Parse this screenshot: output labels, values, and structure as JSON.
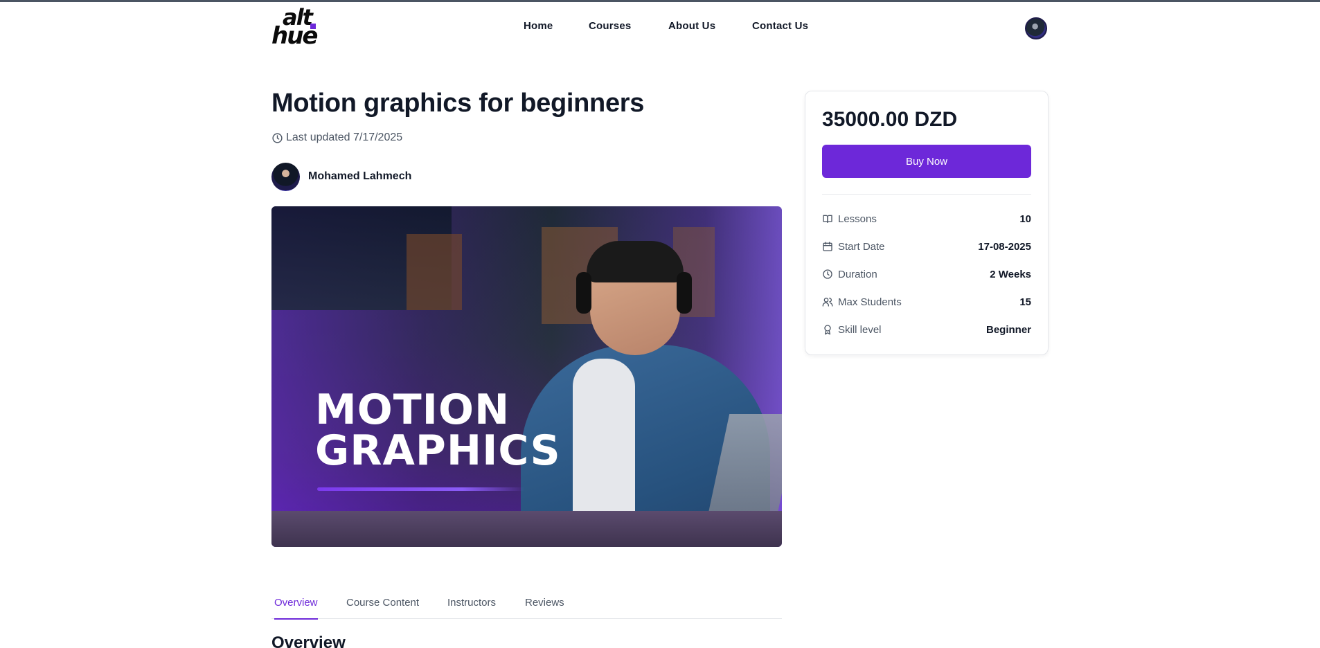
{
  "header": {
    "logo_top": "alt",
    "logo_bottom": "hue",
    "nav": [
      "Home",
      "Courses",
      "About Us",
      "Contact Us"
    ]
  },
  "course": {
    "title": "Motion graphics for beginners",
    "last_updated": "Last updated 7/17/2025",
    "author": "Mohamed Lahmech",
    "hero_line1": "MOTION",
    "hero_line2": "GRAPHICS"
  },
  "tabs": [
    "Overview",
    "Course Content",
    "Instructors",
    "Reviews"
  ],
  "active_tab": "Overview",
  "section_heading": "Overview",
  "sidebar": {
    "price": "35000.00 DZD",
    "buy_label": "Buy Now",
    "details": [
      {
        "icon": "book-icon",
        "label": "Lessons",
        "value": "10"
      },
      {
        "icon": "calendar-icon",
        "label": "Start Date",
        "value": "17-08-2025"
      },
      {
        "icon": "clock-icon",
        "label": "Duration",
        "value": "2 Weeks"
      },
      {
        "icon": "users-icon",
        "label": "Max Students",
        "value": "15"
      },
      {
        "icon": "award-icon",
        "label": "Skill level",
        "value": "Beginner"
      }
    ]
  },
  "colors": {
    "accent": "#6d28d9",
    "text": "#111827",
    "muted": "#4b5563",
    "border": "#e5e7eb"
  }
}
